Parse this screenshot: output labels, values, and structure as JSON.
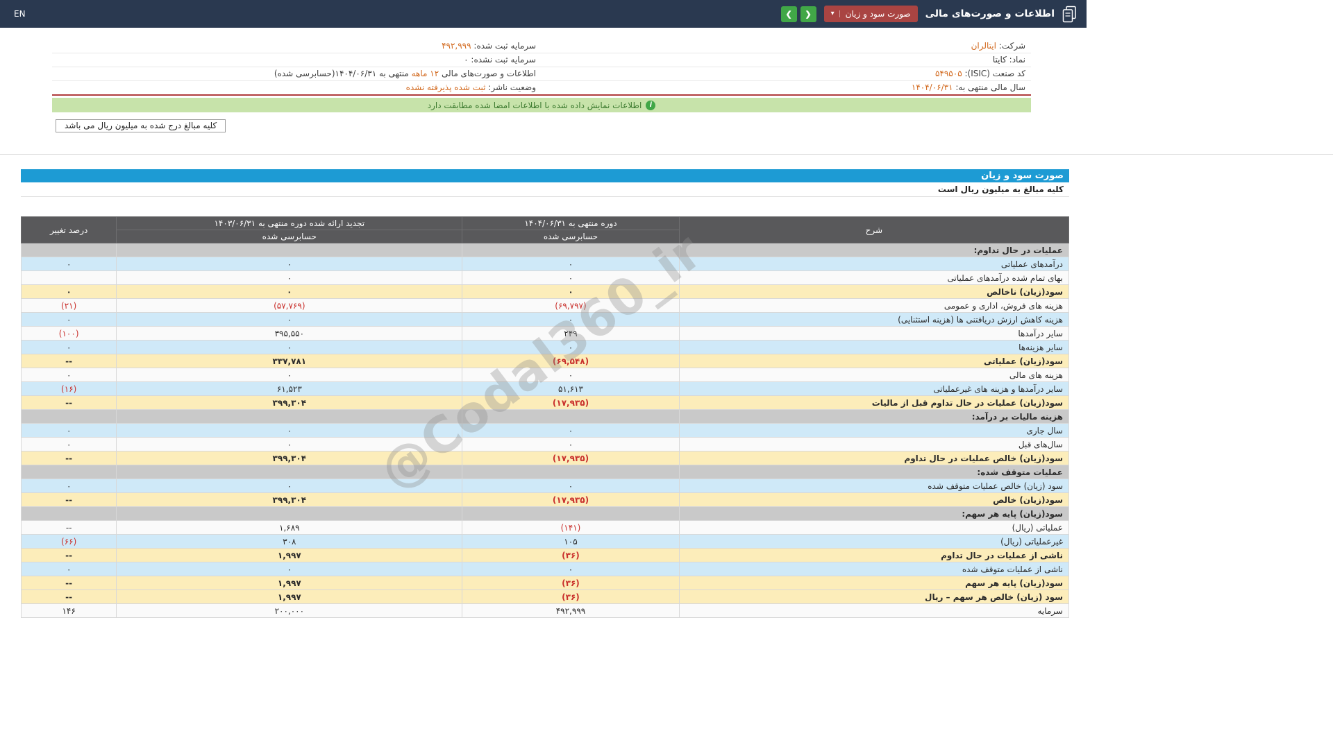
{
  "topbar": {
    "title": "اطلاعات و صورت‌های مالی",
    "statement_select": "صورت سود و زیان",
    "lang": "EN"
  },
  "icons": {
    "chevron_down": "▾",
    "chevron_left": "❮",
    "chevron_right": "❯",
    "info": "i"
  },
  "info": {
    "company_label": "شرکت:",
    "company_value": "ایتالران",
    "symbol_label": "نماد:",
    "symbol_value": "کایتا",
    "isic_label": "کد صنعت (ISIC):",
    "isic_value": "۵۴۹۵۰۵",
    "fiscal_year_label": "سال مالی منتهی به:",
    "fiscal_year_value": "۱۴۰۴/۰۶/۳۱",
    "registered_capital_label": "سرمایه ثبت شده:",
    "registered_capital_value": "۴۹۲,۹۹۹",
    "unregistered_capital_label": "سرمایه ثبت نشده:",
    "unregistered_capital_value": "۰",
    "report_title_prefix": "اطلاعات و صورت‌های مالی",
    "report_period": "۱۲ ماهه",
    "report_title_suffix": "منتهی به ۱۴۰۴/۰۶/۳۱",
    "report_audit_note": "(حسابرسی شده)",
    "publisher_status_label": "وضعیت ناشر:",
    "publisher_status_value": "ثبت شده پذیرفته نشده"
  },
  "banner": {
    "text": "اطلاعات نمایش داده شده با اطلاعات امضا شده مطابقت دارد"
  },
  "units_note": "کلیه مبالغ درج شده به میلیون ریال می باشد",
  "statement": {
    "title": "صورت سود و زیان",
    "units": "کلیه مبالغ به میلیون ریال است",
    "headers": {
      "description": "شرح",
      "current_period": "دوره منتهی به ۱۴۰۴/۰۶/۳۱",
      "restated_period": "تجدید ارائه شده دوره منتهی به ۱۴۰۳/۰۶/۳۱",
      "audited": "حسابرسی شده",
      "change": "درصد تغییر"
    },
    "rows": [
      {
        "label": "عملیات در حال تداوم:",
        "current": "",
        "restated": "",
        "change": "",
        "kind": "section"
      },
      {
        "label": "درآمدهای عملیاتی",
        "current": "۰",
        "restated": "۰",
        "change": "۰",
        "kind": "alt"
      },
      {
        "label": "بهای تمام شده درآمدهای عملیاتی",
        "current": "۰",
        "restated": "۰",
        "change": "",
        "kind": "normal"
      },
      {
        "label": "سود(زیان) ناخالص",
        "current": "۰",
        "restated": "۰",
        "change": "۰",
        "kind": "total"
      },
      {
        "label": "هزینه های فروش، اداری و عمومی",
        "current": "(۶۹,۷۹۷)",
        "restated": "(۵۷,۷۶۹)",
        "change": "(۲۱)",
        "kind": "normal"
      },
      {
        "label": "هزینه کاهش ارزش دریافتنی ها (هزینه استثنایی)",
        "current": "۰",
        "restated": "۰",
        "change": "۰",
        "kind": "alt"
      },
      {
        "label": "سایر درآمدها",
        "current": "۲۴۹",
        "restated": "۳۹۵,۵۵۰",
        "change": "(۱۰۰)",
        "kind": "normal"
      },
      {
        "label": "سایر هزینه‌ها",
        "current": "۰",
        "restated": "۰",
        "change": "۰",
        "kind": "alt"
      },
      {
        "label": "سود(زیان) عملیاتی",
        "current": "(۶۹,۵۴۸)",
        "restated": "۳۳۷,۷۸۱",
        "change": "--",
        "kind": "total"
      },
      {
        "label": "هزینه های مالی",
        "current": "۰",
        "restated": "۰",
        "change": "۰",
        "kind": "normal"
      },
      {
        "label": "سایر درآمدها و هزینه های غیرعملیاتی",
        "current": "۵۱,۶۱۳",
        "restated": "۶۱,۵۲۳",
        "change": "(۱۶)",
        "kind": "alt"
      },
      {
        "label": "سود(زیان) عملیات در حال تداوم قبل از مالیات",
        "current": "(۱۷,۹۳۵)",
        "restated": "۳۹۹,۳۰۴",
        "change": "--",
        "kind": "total"
      },
      {
        "label": "هزینه مالیات بر درآمد:",
        "current": "",
        "restated": "",
        "change": "",
        "kind": "section"
      },
      {
        "label": "سال جاری",
        "current": "۰",
        "restated": "۰",
        "change": "۰",
        "kind": "alt"
      },
      {
        "label": "سال‌های قبل",
        "current": "۰",
        "restated": "۰",
        "change": "۰",
        "kind": "normal"
      },
      {
        "label": "سود(زیان) خالص عملیات در حال تداوم",
        "current": "(۱۷,۹۳۵)",
        "restated": "۳۹۹,۳۰۴",
        "change": "--",
        "kind": "total"
      },
      {
        "label": "عملیات متوقف شده:",
        "current": "",
        "restated": "",
        "change": "",
        "kind": "section"
      },
      {
        "label": "سود (زیان) خالص عملیات متوقف شده",
        "current": "۰",
        "restated": "۰",
        "change": "۰",
        "kind": "alt"
      },
      {
        "label": "سود(زیان) خالص",
        "current": "(۱۷,۹۳۵)",
        "restated": "۳۹۹,۳۰۴",
        "change": "--",
        "kind": "total"
      },
      {
        "label": "سود(زیان) پایه هر سهم:",
        "current": "",
        "restated": "",
        "change": "",
        "kind": "section"
      },
      {
        "label": "عملیاتی (ریال)",
        "current": "(۱۴۱)",
        "restated": "۱,۶۸۹",
        "change": "--",
        "kind": "normal"
      },
      {
        "label": "غیرعملیاتی (ریال)",
        "current": "۱۰۵",
        "restated": "۳۰۸",
        "change": "(۶۶)",
        "kind": "alt"
      },
      {
        "label": "ناشی از عملیات در حال تداوم",
        "current": "(۳۶)",
        "restated": "۱,۹۹۷",
        "change": "--",
        "kind": "total"
      },
      {
        "label": "ناشی از عملیات متوقف شده",
        "current": "۰",
        "restated": "۰",
        "change": "۰",
        "kind": "alt"
      },
      {
        "label": "سود(زیان) پایه هر سهم",
        "current": "(۳۶)",
        "restated": "۱,۹۹۷",
        "change": "--",
        "kind": "total"
      },
      {
        "label": "سود (زیان) خالص هر سهم – ریال",
        "current": "(۳۶)",
        "restated": "۱,۹۹۷",
        "change": "--",
        "kind": "total"
      },
      {
        "label": "سرمایه",
        "current": "۴۹۲,۹۹۹",
        "restated": "۲۰۰,۰۰۰",
        "change": "۱۴۶",
        "kind": "normal"
      }
    ]
  },
  "watermark": "@Codal360_ir",
  "colors": {
    "topbar_bg": "#2a3950",
    "statement_select_bg": "#a94442",
    "nav_button_green": "#41a747",
    "banner_green_bg": "#c7e3aa",
    "banner_green_text": "#3c7a2f",
    "section_title_blue": "#1d9bd4",
    "table_header_gray": "#59595b",
    "row_alt_blue": "#cfe9f8",
    "row_total_yellow": "#fcedba",
    "row_section_gray": "#c9c9c9",
    "negative_red": "#c9302c",
    "highlight_orange": "#d2691e"
  }
}
